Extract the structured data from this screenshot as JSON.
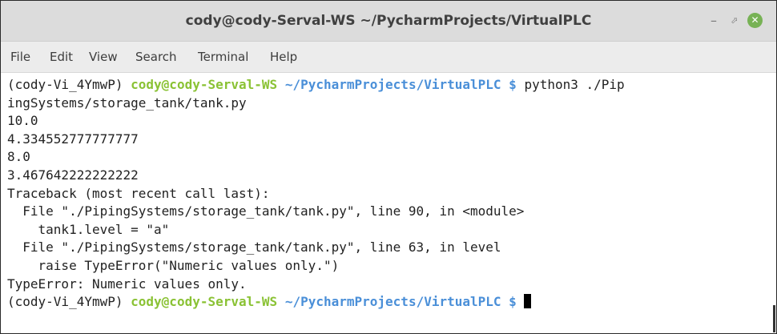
{
  "window": {
    "title": "cody@cody-Serval-WS ~/PycharmProjects/VirtualPLC",
    "minimize_glyph": "–",
    "maximize_glyph": "⬀",
    "close_glyph": "✕",
    "close_color": "#77b255"
  },
  "menu": {
    "items": [
      "File",
      "Edit",
      "View",
      "Search",
      "Terminal",
      "Help"
    ]
  },
  "terminal": {
    "prompt": {
      "env": "(cody-Vi_4YmwP)",
      "user_host": "cody@cody-Serval-WS",
      "path": "~/PycharmProjects/VirtualPLC",
      "symbol": "$"
    },
    "command": "python3 ./Pip",
    "command_wrap": "ingSystems/storage_tank/tank.py",
    "output": [
      "10.0",
      "4.334552777777777",
      "8.0",
      "3.467642222222222",
      "Traceback (most recent call last):",
      "  File \"./PipingSystems/storage_tank/tank.py\", line 90, in <module>",
      "    tank1.level = \"a\"",
      "  File \"./PipingSystems/storage_tank/tank.py\", line 63, in level",
      "    raise TypeError(\"Numeric values only.\")",
      "TypeError: Numeric values only."
    ],
    "colors": {
      "user_host": "#8ac234",
      "path": "#4a8fd8"
    }
  }
}
